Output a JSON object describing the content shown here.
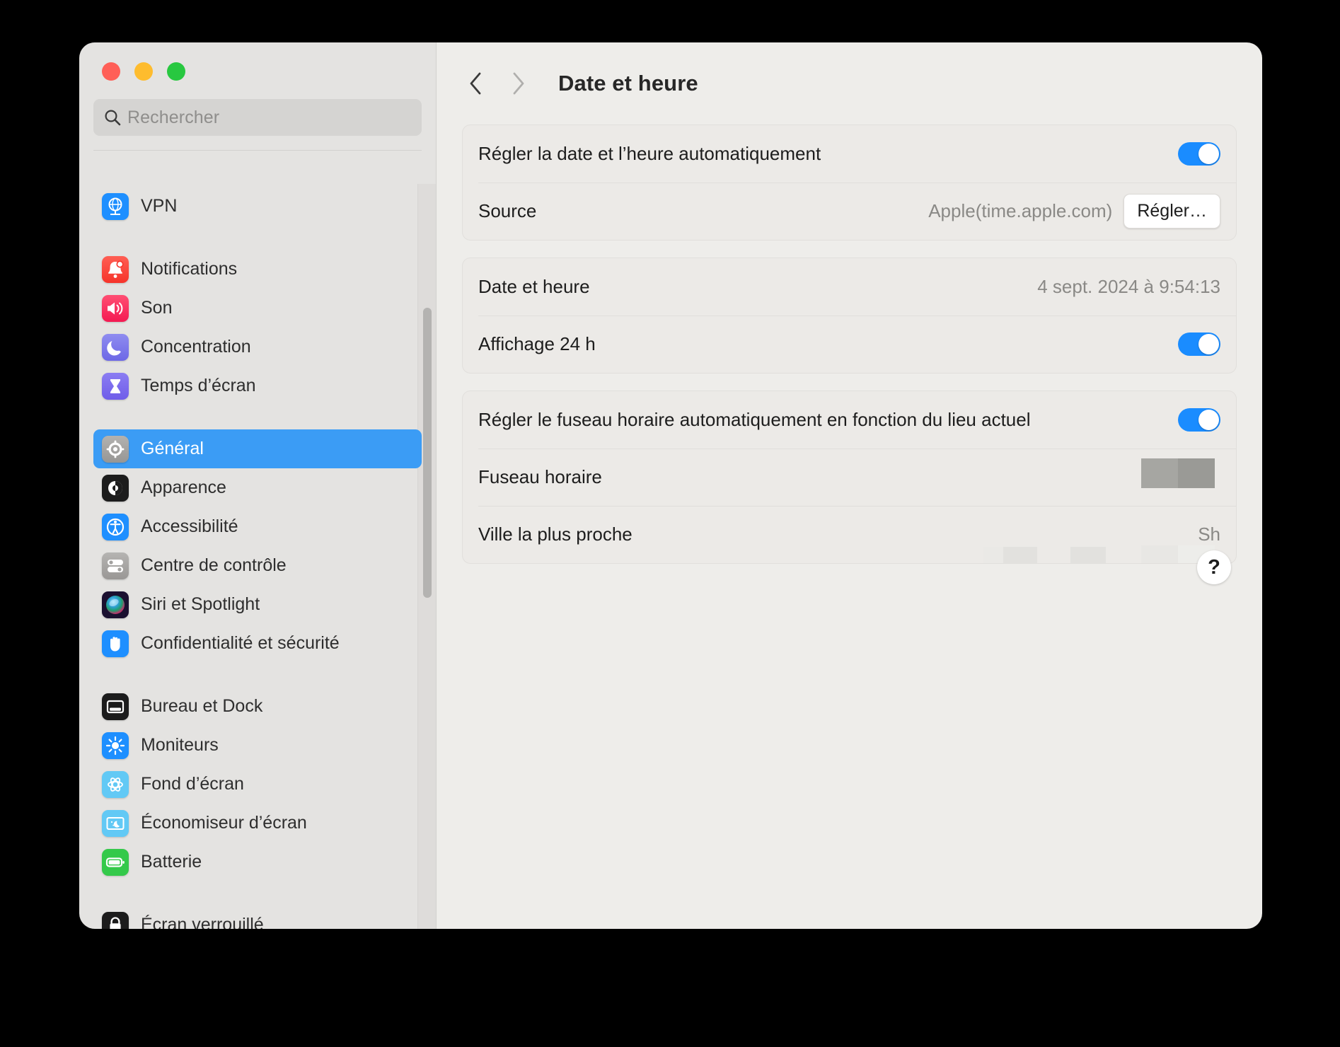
{
  "window": {
    "traffic_lights": [
      "close",
      "minimize",
      "zoom"
    ],
    "colors": {
      "close": "#ff5f57",
      "minimize": "#febc2e",
      "zoom": "#28c840",
      "accent": "#3b9cf5",
      "toggle_on": "#1a8cff"
    }
  },
  "search": {
    "placeholder": "Rechercher",
    "value": "",
    "icon": "search-icon"
  },
  "sidebar": {
    "groups": [
      {
        "items": [
          {
            "label": "VPN",
            "icon": "vpn-icon",
            "selected": false
          }
        ]
      },
      {
        "items": [
          {
            "label": "Notifications",
            "icon": "notifications-icon",
            "selected": false
          },
          {
            "label": "Son",
            "icon": "sound-icon",
            "selected": false
          },
          {
            "label": "Concentration",
            "icon": "focus-icon",
            "selected": false
          },
          {
            "label": "Temps d’écran",
            "icon": "screen-time-icon",
            "selected": false
          }
        ]
      },
      {
        "items": [
          {
            "label": "Général",
            "icon": "general-gear-icon",
            "selected": true
          },
          {
            "label": "Apparence",
            "icon": "appearance-icon",
            "selected": false
          },
          {
            "label": "Accessibilité",
            "icon": "accessibility-icon",
            "selected": false
          },
          {
            "label": "Centre de contrôle",
            "icon": "control-center-icon",
            "selected": false
          },
          {
            "label": "Siri et Spotlight",
            "icon": "siri-icon",
            "selected": false
          },
          {
            "label": "Confidentialité et sécurité",
            "icon": "privacy-hand-icon",
            "selected": false
          }
        ]
      },
      {
        "items": [
          {
            "label": "Bureau et Dock",
            "icon": "desktop-dock-icon",
            "selected": false
          },
          {
            "label": "Moniteurs",
            "icon": "displays-icon",
            "selected": false
          },
          {
            "label": "Fond d’écran",
            "icon": "wallpaper-icon",
            "selected": false
          },
          {
            "label": "Économiseur d’écran",
            "icon": "screensaver-icon",
            "selected": false
          },
          {
            "label": "Batterie",
            "icon": "battery-icon",
            "selected": false
          }
        ]
      },
      {
        "items": [
          {
            "label": "Écran verrouillé",
            "icon": "lock-screen-icon",
            "selected": false
          }
        ]
      }
    ]
  },
  "toolbar": {
    "back_icon": "chevron-left-icon",
    "forward_icon": "chevron-right-icon",
    "title": "Date et heure"
  },
  "main": {
    "panels": [
      {
        "rows": [
          {
            "label": "Régler la date et l’heure automatiquement",
            "control": "toggle",
            "toggle_on": true
          },
          {
            "label": "Source",
            "value": "Apple(time.apple.com)",
            "button": "Régler…"
          }
        ]
      },
      {
        "rows": [
          {
            "label": "Date et heure",
            "value": "4 sept. 2024 à 9:54:13"
          },
          {
            "label": "Affichage 24 h",
            "control": "toggle",
            "toggle_on": true
          }
        ]
      },
      {
        "rows": [
          {
            "label": "Régler le fuseau horaire automatiquement en fonction du lieu actuel",
            "control": "toggle",
            "toggle_on": true
          },
          {
            "label": "Fuseau horaire",
            "value": "",
            "redacted": true
          },
          {
            "label": "Ville la plus proche",
            "value": "Sh",
            "redacted": true
          }
        ]
      }
    ],
    "help_button": {
      "label": "?",
      "icon": "help-icon"
    }
  }
}
